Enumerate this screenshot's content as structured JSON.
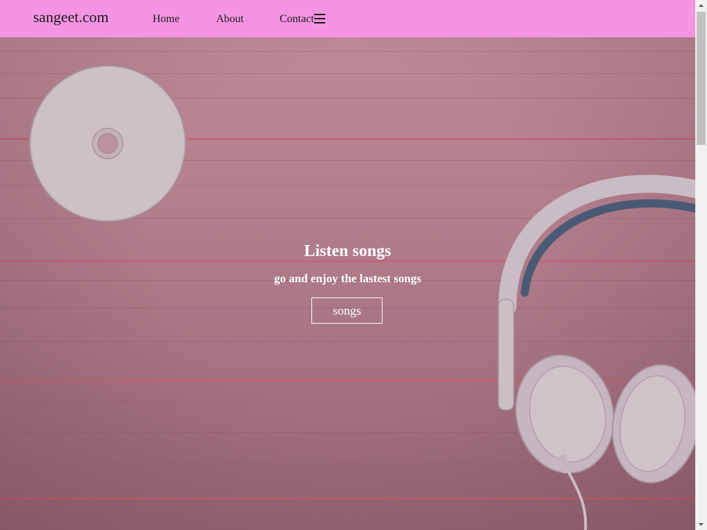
{
  "navbar": {
    "brand": "sangeet.com",
    "links": [
      {
        "label": "Home"
      },
      {
        "label": "About"
      },
      {
        "label": "Contact"
      }
    ],
    "menu_icon": "hamburger-menu-icon",
    "background_color": "#f494e2"
  },
  "hero": {
    "title": "Listen songs",
    "subtitle": "go and enjoy the lastest songs",
    "button_label": "songs",
    "background_image": "pink-wooden-planks-with-cd-disc-and-headphones"
  },
  "scrollbar": {
    "up_icon": "scroll-up-arrow-icon",
    "down_icon": "scroll-down-arrow-icon"
  }
}
